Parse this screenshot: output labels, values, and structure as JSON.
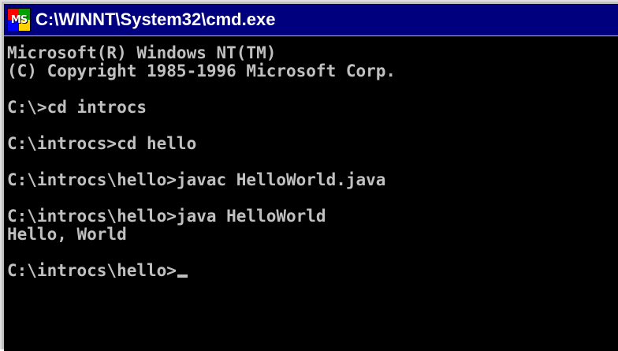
{
  "window": {
    "title": "C:\\WINNT\\System32\\cmd.exe",
    "icon": "ms-dos-icon",
    "icon_text": "MS"
  },
  "colors": {
    "titlebar": "#00007f",
    "console_bg": "#000000",
    "console_text": "#c0c0c0"
  },
  "console": {
    "lines": [
      "Microsoft(R) Windows NT(TM)",
      "(C) Copyright 1985-1996 Microsoft Corp.",
      "",
      "C:\\>cd introcs",
      "",
      "C:\\introcs>cd hello",
      "",
      "C:\\introcs\\hello>javac HelloWorld.java",
      "",
      "C:\\introcs\\hello>java HelloWorld",
      "Hello, World",
      "",
      "C:\\introcs\\hello>"
    ]
  }
}
